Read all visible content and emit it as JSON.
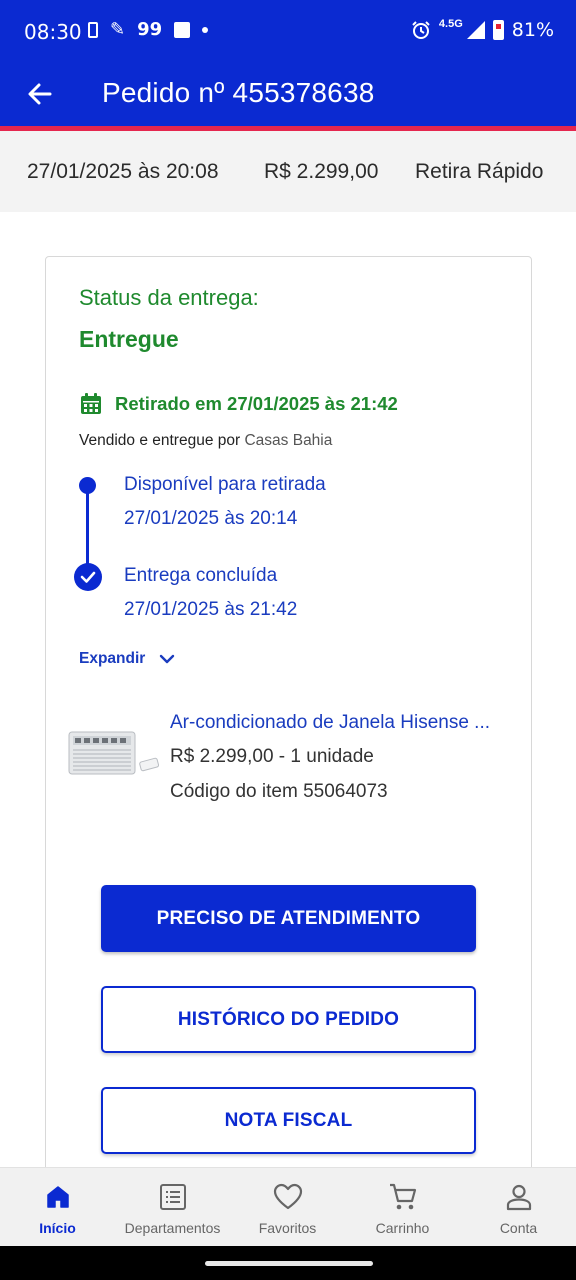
{
  "status_bar": {
    "time": "08:30",
    "badge_99": "99",
    "network": "4.5G",
    "battery": "81%"
  },
  "header": {
    "title": "Pedido nº 455378638"
  },
  "summary": {
    "date": "27/01/2025 às 20:08",
    "total": "R$ 2.299,00",
    "delivery_type": "Retira Rápido"
  },
  "delivery": {
    "status_label": "Status da entrega:",
    "status_value": "Entregue",
    "pickup_text": "Retirado em 27/01/2025 às 21:42",
    "sold_by_prefix": "Vendido e entregue por",
    "sold_by_name": "Casas Bahia",
    "timeline": [
      {
        "label": "Disponível para retirada",
        "date": "27/01/2025 às 20:14"
      },
      {
        "label": "Entrega concluída",
        "date": "27/01/2025 às 21:42"
      }
    ],
    "expand_label": "Expandir"
  },
  "product": {
    "name": "Ar-condicionado de Janela Hisense ...",
    "price_qty": "R$ 2.299,00 - 1 unidade",
    "code": "Código do item 55064073"
  },
  "buttons": {
    "help": "PRECISO DE ATENDIMENTO",
    "history": "HISTÓRICO DO PEDIDO",
    "invoice": "NOTA FISCAL"
  },
  "bottom_nav": [
    {
      "label": "Início",
      "icon": "home-icon",
      "active": true
    },
    {
      "label": "Departamentos",
      "icon": "departments-icon",
      "active": false
    },
    {
      "label": "Favoritos",
      "icon": "heart-icon",
      "active": false
    },
    {
      "label": "Carrinho",
      "icon": "cart-icon",
      "active": false
    },
    {
      "label": "Conta",
      "icon": "user-icon",
      "active": false
    }
  ],
  "colors": {
    "brand_blue": "#0b2ad1",
    "accent_red": "#e5264e",
    "success_green": "#1f8a2e",
    "link_blue": "#1a3cbf"
  }
}
